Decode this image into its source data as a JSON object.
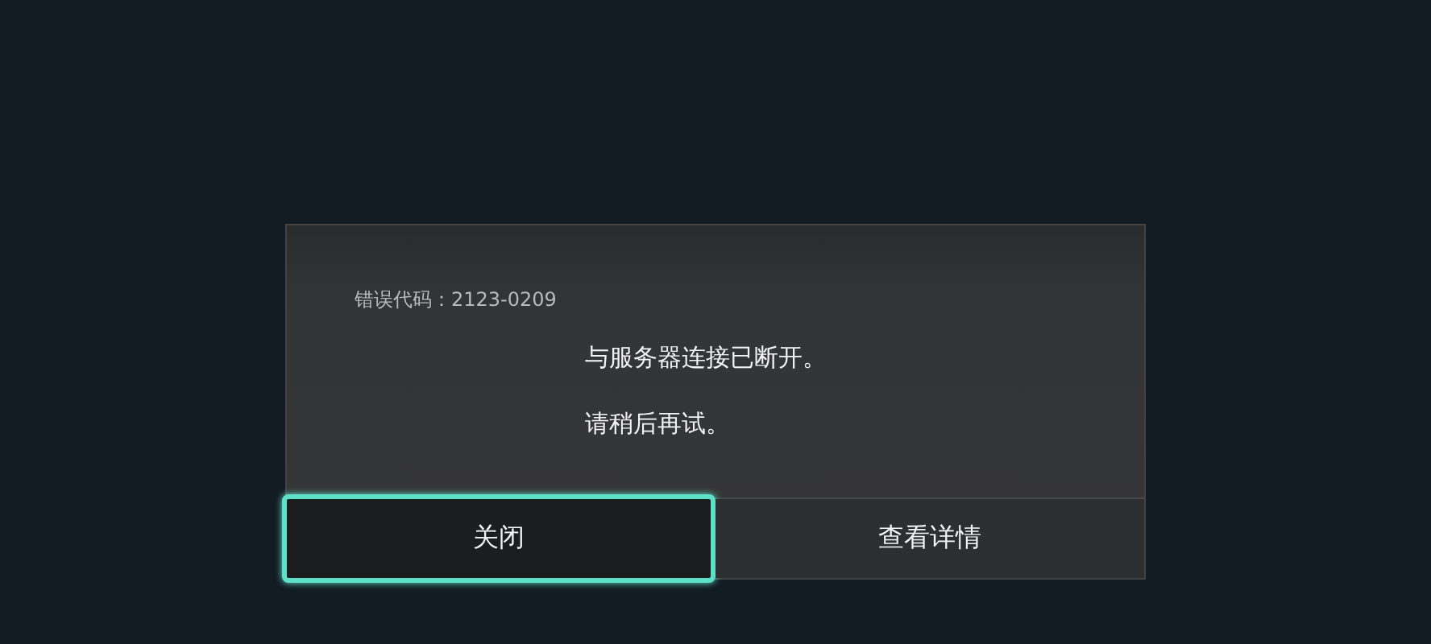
{
  "dialog": {
    "error_code": "错误代码：2123-0209",
    "message_lines": [
      "与服务器连接已断开。",
      "请稍后再试。"
    ],
    "buttons": [
      {
        "label": "关闭",
        "selected": true
      },
      {
        "label": "查看详情",
        "selected": false
      }
    ]
  }
}
